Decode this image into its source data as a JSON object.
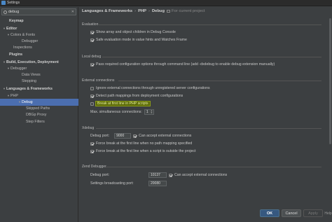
{
  "window": {
    "title": "Settings"
  },
  "search": {
    "value": "debug"
  },
  "tree": [
    {
      "label": "Keymap",
      "bold": true,
      "lvl": "l0",
      "arrow": ""
    },
    {
      "label": "Editor",
      "bold": true,
      "lvl": "l0a",
      "arrow": "▼"
    },
    {
      "label": "Colors & Fonts",
      "bold": false,
      "lvl": "l1a",
      "arrow": "▼"
    },
    {
      "label": "Debugger",
      "bold": false,
      "lvl": "l2",
      "arrow": ""
    },
    {
      "label": "Inspections",
      "bold": false,
      "lvl": "l1",
      "arrow": ""
    },
    {
      "label": "Plugins",
      "bold": true,
      "lvl": "l0",
      "arrow": ""
    },
    {
      "label": "Build, Execution, Deployment",
      "bold": true,
      "lvl": "l0a",
      "arrow": "▼"
    },
    {
      "label": "Debugger",
      "bold": false,
      "lvl": "l1a",
      "arrow": "▼"
    },
    {
      "label": "Data Views",
      "bold": false,
      "lvl": "l2",
      "arrow": ""
    },
    {
      "label": "Stepping",
      "bold": false,
      "lvl": "l2",
      "arrow": ""
    },
    {
      "label": "Languages & Frameworks",
      "bold": true,
      "lvl": "l0a",
      "arrow": "▼"
    },
    {
      "label": "PHP",
      "bold": false,
      "lvl": "l1a",
      "arrow": "▼"
    },
    {
      "label": "Debug",
      "bold": false,
      "lvl": "l2",
      "arrow": "▼",
      "selected": true
    },
    {
      "label": "Skipped Paths",
      "bold": false,
      "lvl": "l3",
      "arrow": ""
    },
    {
      "label": "DBGp Proxy",
      "bold": false,
      "lvl": "l3",
      "arrow": ""
    },
    {
      "label": "Step Filters",
      "bold": false,
      "lvl": "l3",
      "arrow": ""
    }
  ],
  "breadcrumb": {
    "part1": "Languages & Frameworks",
    "sep1": "›",
    "part2": "PHP",
    "sep2": "›",
    "part3": "Debug",
    "note": "For current project"
  },
  "evaluation": {
    "header": "Evaluation",
    "show_array": "Show array and object children in Debug Console",
    "safe_eval": "Safe evaluation mode in value hints and Watches Frame"
  },
  "local_debug": {
    "header": "Local debug",
    "pass_config": "Pass required configuration options through command line (add -dxdebug to enable debug extension manually)"
  },
  "external": {
    "header": "External connections",
    "ignore": "Ignore external connections through unregistered server configurations",
    "detect": "Detect path mappings from deployment configurations",
    "break_first": "Break at first line in PHP scripts",
    "max_label": "Max. simultaneous connections:",
    "max_value": "1"
  },
  "xdebug": {
    "header": "Xdebug",
    "port_label": "Debug port:",
    "port_value": "9000",
    "accept": "Can accept external connections",
    "force_no_map": "Force break at the first line when no path mapping specified",
    "force_outside": "Force break at the first line when a script is outside the project"
  },
  "zend": {
    "header": "Zend Debugger",
    "port_label": "Debug port:",
    "port_value": "10137",
    "accept": "Can accept external connections",
    "broadcast_label": "Settings broadcasting port:",
    "broadcast_value": "20080"
  },
  "buttons": {
    "ok": "OK",
    "cancel": "Cancel",
    "apply": "Apply",
    "help": "Help"
  }
}
